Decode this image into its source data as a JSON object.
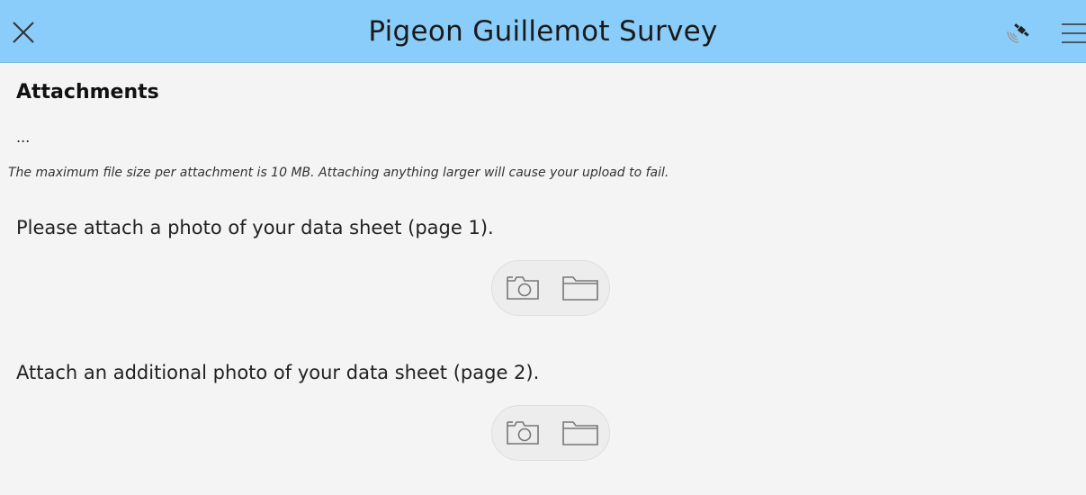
{
  "header": {
    "title": "Pigeon Guillemot Survey",
    "background_color": "#8acdfa",
    "close_icon": "close-icon",
    "gps_icon": "satellite-icon",
    "menu_icon": "hamburger-menu-icon"
  },
  "section": {
    "title": "Attachments",
    "ellipsis": "...",
    "hint": "The maximum file size per attachment is 10 MB. Attaching anything larger will cause your upload to fail."
  },
  "questions": [
    {
      "label": "Please attach a photo of your data sheet (page 1).",
      "buttons": [
        "camera-icon",
        "folder-icon"
      ]
    },
    {
      "label": "Attach an additional photo of your data sheet (page 2).",
      "buttons": [
        "camera-icon",
        "folder-icon"
      ]
    }
  ]
}
